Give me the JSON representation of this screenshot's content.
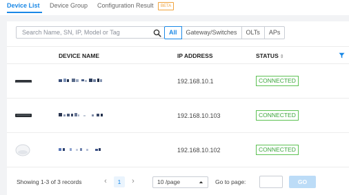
{
  "tabs": [
    {
      "label": "Device List",
      "active": true
    },
    {
      "label": "Device Group",
      "active": false
    },
    {
      "label": "Configuration Result",
      "active": false
    }
  ],
  "beta_badge": "BETA",
  "search": {
    "placeholder": "Search Name, SN, IP, Model or Tag",
    "value": ""
  },
  "filters": [
    "All",
    "Gateway/Switches",
    "OLTs",
    "APs"
  ],
  "active_filter": "All",
  "table": {
    "columns": [
      "DEVICE NAME",
      "IP ADDRESS",
      "STATUS"
    ],
    "rows": [
      {
        "icon": "gateway-device-icon",
        "name": "(obscured)",
        "ip": "192.168.10.1",
        "status": "CONNECTED"
      },
      {
        "icon": "switch-device-icon",
        "name": "(obscured)",
        "ip": "192.168.10.103",
        "status": "CONNECTED"
      },
      {
        "icon": "access-point-icon",
        "name": "(obscured)",
        "ip": "192.168.10.102",
        "status": "CONNECTED"
      }
    ]
  },
  "footer": {
    "records": "Showing 1-3 of 3 records",
    "current_page": "1",
    "page_size": "10 /page",
    "goto_label": "Go to page:",
    "go_label": "GO"
  },
  "colors": {
    "accent": "#1a88e6",
    "status_connected": "#3aa53a",
    "beta": "#f0a23a"
  }
}
